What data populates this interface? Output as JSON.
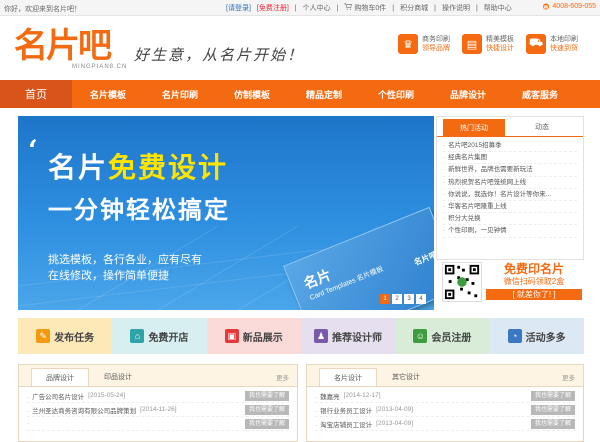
{
  "topbar": {
    "welcome": "你好，欢迎来到名片吧！",
    "login": "[请登录]",
    "register": "[免费注册]",
    "user_center": "个人中心",
    "cart": "购物车0件",
    "points_mall": "积分商城",
    "help": "操作说明",
    "help_center": "帮助中心",
    "phone": "4008-609-055"
  },
  "header": {
    "logo_text": "名片吧",
    "logo_sub": "MINGPIAN8.CN",
    "slogan": "好生意，从名片开始！",
    "services": [
      {
        "icon": "trophy-icon",
        "glyph": "♛",
        "line1": "商务印刷",
        "line2": "领导品牌"
      },
      {
        "icon": "template-icon",
        "glyph": "▤",
        "line1": "精美模板",
        "line2": "快捷设计"
      },
      {
        "icon": "truck-icon",
        "glyph": "⛟",
        "line1": "本地印刷",
        "line2": "快速到货"
      }
    ]
  },
  "nav": {
    "items": [
      "首页",
      "名片模板",
      "名片印刷",
      "仿制模板",
      "精品定制",
      "个性印刷",
      "品牌设计",
      "威客服务"
    ]
  },
  "banner": {
    "title_a": "名片",
    "title_b": "免费设计",
    "subtitle": "一分钟轻松搞定",
    "desc1": "挑选模板，各行各业，应有尽有",
    "desc2": "在线修改，操作简单便捷",
    "card_title": "名片",
    "card_sub": "Card Templates 名片模板",
    "card_brand": "名片吧",
    "dots": [
      "1",
      "2",
      "3",
      "4"
    ],
    "active_dot": 1
  },
  "news": {
    "tabs": [
      "热门活动",
      "动态"
    ],
    "items": [
      "名片吧2015招募季",
      "经典名片集图",
      "新鲜世界，品牌也需要新玩法",
      "热烈祝贺名片吧笼统网上线",
      "你说说，我选你！名片设计等你来...",
      "华客名片吧隆重上线",
      "积分大兑换",
      "个性印刷，一见钟情"
    ]
  },
  "promo": {
    "line1": "免费印名片",
    "line2": "微信扫码领取2盒",
    "line3": "[ 就差你了! ]"
  },
  "tiles": [
    {
      "icon": "edit-icon",
      "glyph": "✎",
      "label": "发布任务"
    },
    {
      "icon": "shop-icon",
      "glyph": "⌂",
      "label": "免费开店"
    },
    {
      "icon": "image-icon",
      "glyph": "▣",
      "label": "新品展示"
    },
    {
      "icon": "designer-icon",
      "glyph": "♟",
      "label": "推荐设计师"
    },
    {
      "icon": "member-icon",
      "glyph": "☺",
      "label": "会员注册"
    },
    {
      "icon": "activity-icon",
      "glyph": "◔",
      "label": "活动多多"
    }
  ],
  "panel_left": {
    "tabs": [
      "品牌设计",
      "印品设计"
    ],
    "more": "更多",
    "rows": [
      {
        "name": "广告公司名片设计",
        "date": "[2015-05-24]",
        "action": "我也需要了解"
      },
      {
        "name": "兰州圣达商务咨询有限公司品牌策划",
        "date": "[2014-11-26]",
        "action": "我也需要了解"
      },
      {
        "name": "",
        "date": "",
        "action": "我也需要了解"
      }
    ]
  },
  "panel_right": {
    "tabs": [
      "名片设计",
      "其它设计"
    ],
    "more": "更多",
    "rows": [
      {
        "name": "魏嘉亮",
        "date": "[2014-12-17]",
        "action": "我也需要了解"
      },
      {
        "name": "银行业务员工设计",
        "date": "[2013-04-09]",
        "action": "我也需要了解"
      },
      {
        "name": "淘宝店铺员工设计",
        "date": "[2013-04-09]",
        "action": "我也需要了解"
      }
    ]
  }
}
